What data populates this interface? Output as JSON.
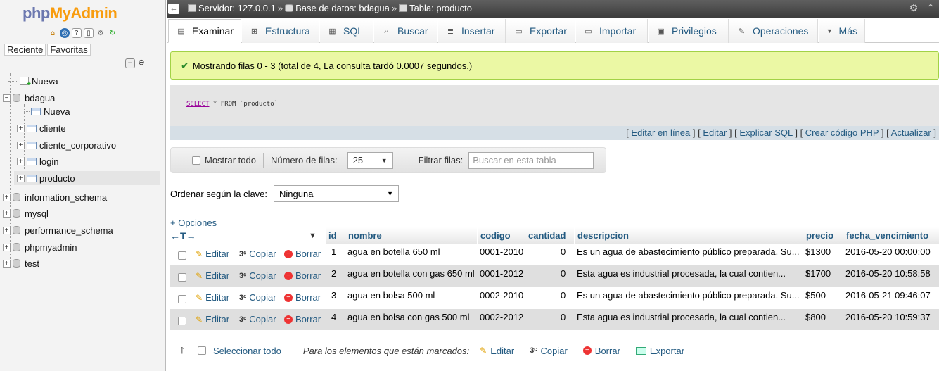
{
  "sidebar": {
    "logo_php": "php",
    "logo_myadmin": "MyAdmin",
    "tab_recent": "Reciente",
    "tab_favorites": "Favoritas",
    "tree": [
      {
        "label": "Nueva",
        "type": "new"
      },
      {
        "label": "bdagua",
        "type": "db"
      },
      {
        "label": "Nueva",
        "type": "new-child"
      },
      {
        "label": "cliente",
        "type": "table"
      },
      {
        "label": "cliente_corporativo",
        "type": "table"
      },
      {
        "label": "login",
        "type": "table"
      },
      {
        "label": "producto",
        "type": "table"
      },
      {
        "label": "information_schema",
        "type": "db"
      },
      {
        "label": "mysql",
        "type": "db"
      },
      {
        "label": "performance_schema",
        "type": "db"
      },
      {
        "label": "phpmyadmin",
        "type": "db"
      },
      {
        "label": "test",
        "type": "db"
      }
    ]
  },
  "breadcrumb": {
    "server": "Servidor: 127.0.0.1",
    "database": "Base de datos: bdagua",
    "table": "Tabla: producto",
    "separator": "»"
  },
  "tabs": [
    {
      "label": "Examinar",
      "icon": "browse-icon",
      "glyph": "▤"
    },
    {
      "label": "Estructura",
      "icon": "structure-icon",
      "glyph": "⊞"
    },
    {
      "label": "SQL",
      "icon": "sql-icon",
      "glyph": "▦"
    },
    {
      "label": "Buscar",
      "icon": "search-icon",
      "glyph": "⌕"
    },
    {
      "label": "Insertar",
      "icon": "insert-icon",
      "glyph": "≣"
    },
    {
      "label": "Exportar",
      "icon": "export-icon",
      "glyph": "▭"
    },
    {
      "label": "Importar",
      "icon": "import-icon",
      "glyph": "▭"
    },
    {
      "label": "Privilegios",
      "icon": "privileges-icon",
      "glyph": "▣"
    },
    {
      "label": "Operaciones",
      "icon": "operations-icon",
      "glyph": "✎"
    },
    {
      "label": "Más",
      "icon": "chevron-down-icon",
      "glyph": "▼"
    }
  ],
  "message": "Mostrando filas 0 - 3 (total de 4, La consulta tardó 0.0007 segundos.)",
  "sql": {
    "select": "SELECT",
    "rest": " * FROM `producto`"
  },
  "sql_links": [
    "Editar en línea",
    "Editar",
    "Explicar SQL",
    "Crear código PHP",
    "Actualizar"
  ],
  "navigation": {
    "show_all": "Mostrar todo",
    "rows_label": "Número de filas:",
    "rows_value": "25",
    "filter_label": "Filtrar filas:",
    "filter_placeholder": "Buscar en esta tabla"
  },
  "order": {
    "label": "Ordenar según la clave:",
    "value": "Ninguna"
  },
  "options_link": "+ Opciones",
  "table": {
    "columns": [
      "id",
      "nombre",
      "codigo",
      "cantidad",
      "descripcion",
      "precio",
      "fecha_vencimiento"
    ],
    "row_actions": {
      "edit": "Editar",
      "copy": "Copiar",
      "delete": "Borrar"
    },
    "rows": [
      {
        "id": "1",
        "nombre": "agua en botella 650 ml",
        "codigo": "0001-2010",
        "cantidad": "0",
        "descripcion": "Es un agua de abastecimiento público preparada. Su...",
        "precio": "$1300",
        "fecha_vencimiento": "2016-05-20 00:00:00"
      },
      {
        "id": "2",
        "nombre": "agua en botella con gas 650 ml",
        "codigo": "0001-2012",
        "cantidad": "0",
        "descripcion": "Esta agua es industrial procesada, la cual contien...",
        "precio": "$1700",
        "fecha_vencimiento": "2016-05-20 10:58:58"
      },
      {
        "id": "3",
        "nombre": "agua en bolsa 500 ml",
        "codigo": "0002-2010",
        "cantidad": "0",
        "descripcion": "Es un agua de abastecimiento público preparada. Su...",
        "precio": "$500",
        "fecha_vencimiento": "2016-05-21 09:46:07"
      },
      {
        "id": "4",
        "nombre": "agua en bolsa con gas 500 ml",
        "codigo": "0002-2012",
        "cantidad": "0",
        "descripcion": "Esta agua es industrial procesada, la cual contien...",
        "precio": "$800",
        "fecha_vencimiento": "2016-05-20 10:59:37"
      }
    ]
  },
  "footer": {
    "select_all": "Seleccionar todo",
    "with_selected": "Para los elementos que están marcados:",
    "edit": "Editar",
    "copy": "Copiar",
    "delete": "Borrar",
    "export": "Exportar"
  }
}
